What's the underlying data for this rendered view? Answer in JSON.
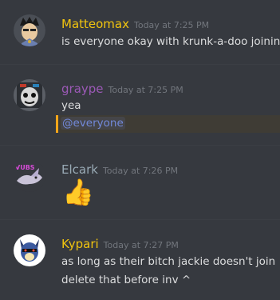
{
  "messages": [
    {
      "author": "Matteomax",
      "author_color": "#f1c40f",
      "timestamp": "Today at 7:25 PM",
      "lines": [
        "is everyone okay with krunk-a-doo joining"
      ]
    },
    {
      "author": "graype",
      "author_color": "#9b59b6",
      "timestamp": "Today at 7:25 PM",
      "lines": [
        "yea"
      ],
      "mention": "@everyone"
    },
    {
      "author": "Elcark",
      "author_color": "#99aab5",
      "timestamp": "Today at 7:26 PM",
      "emoji": "👍",
      "avatar_text": "VUBS"
    },
    {
      "author": "Kypari",
      "author_color": "#f1c40f",
      "timestamp": "Today at 7:27 PM",
      "lines": [
        "as long as their bitch jackie doesn't join",
        "delete that before inv ^"
      ]
    }
  ],
  "colors": {
    "background": "#36393f",
    "text": "#dcddde",
    "timestamp": "#72767d",
    "mention": "#7289da",
    "mention_highlight": "#faa61a"
  }
}
